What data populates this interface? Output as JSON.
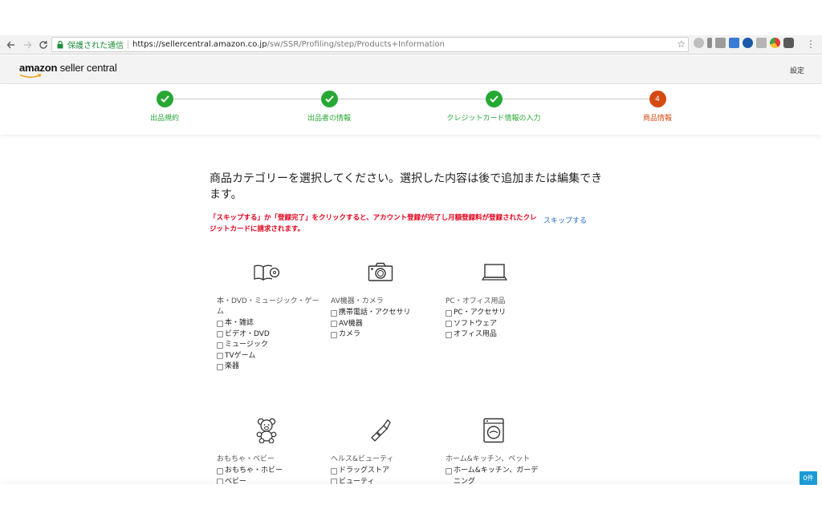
{
  "browser": {
    "secure_label": "保護された通信",
    "url_host": "https://sellercentral.amazon.co.jp",
    "url_path": "/sw/SSR/Profiling/step/Products+Information"
  },
  "header": {
    "logo_bold": "amazon",
    "logo_rest": " seller central",
    "settings": "設定"
  },
  "steps": [
    {
      "label": "出品規約",
      "state": "done"
    },
    {
      "label": "出品者の情報",
      "state": "done"
    },
    {
      "label": "クレジットカード情報の入力",
      "state": "done"
    },
    {
      "label": "商品情報",
      "state": "active",
      "number": "4"
    }
  ],
  "main": {
    "headline": "商品カテゴリーを選択してください。選択した内容は後で追加または編集できます。",
    "warning": "「スキップする」か「登録完了」をクリックすると、アカウント登録が完了し月額登録料が登録されたクレジットカードに請求されます。",
    "skip_link": "スキップする"
  },
  "categories": [
    {
      "title": "本・DVD・ミュージック・ゲーム",
      "icon": "book-cd-icon",
      "items": [
        "本・雑誌",
        "ビデオ・DVD",
        "ミュージック",
        "TVゲーム",
        "楽器"
      ]
    },
    {
      "title": "AV機器・カメラ",
      "icon": "camera-icon",
      "items": [
        "携帯電話・アクセサリ",
        "AV機器",
        "カメラ"
      ]
    },
    {
      "title": "PC・オフィス用品",
      "icon": "laptop-icon",
      "items": [
        "PC・アクセサリ",
        "ソフトウェア",
        "オフィス用品"
      ]
    },
    {
      "title": "おもちゃ・ベビー",
      "icon": "teddy-bear-icon",
      "items": [
        "おもちゃ・ホビー",
        "ベビー"
      ]
    },
    {
      "title": "ヘルス&ビューティ",
      "icon": "lipstick-icon",
      "items": [
        "ドラッグストア",
        "ビューティ"
      ]
    },
    {
      "title": "ホーム&キッチン、ペット",
      "icon": "washing-machine-icon",
      "items": [
        "ホーム&キッチン、ガーデニング"
      ]
    }
  ],
  "badge": "0件",
  "colors": {
    "done": "#26a833",
    "active": "#d54a12",
    "warning": "#e4001b",
    "link": "#2968c8"
  }
}
